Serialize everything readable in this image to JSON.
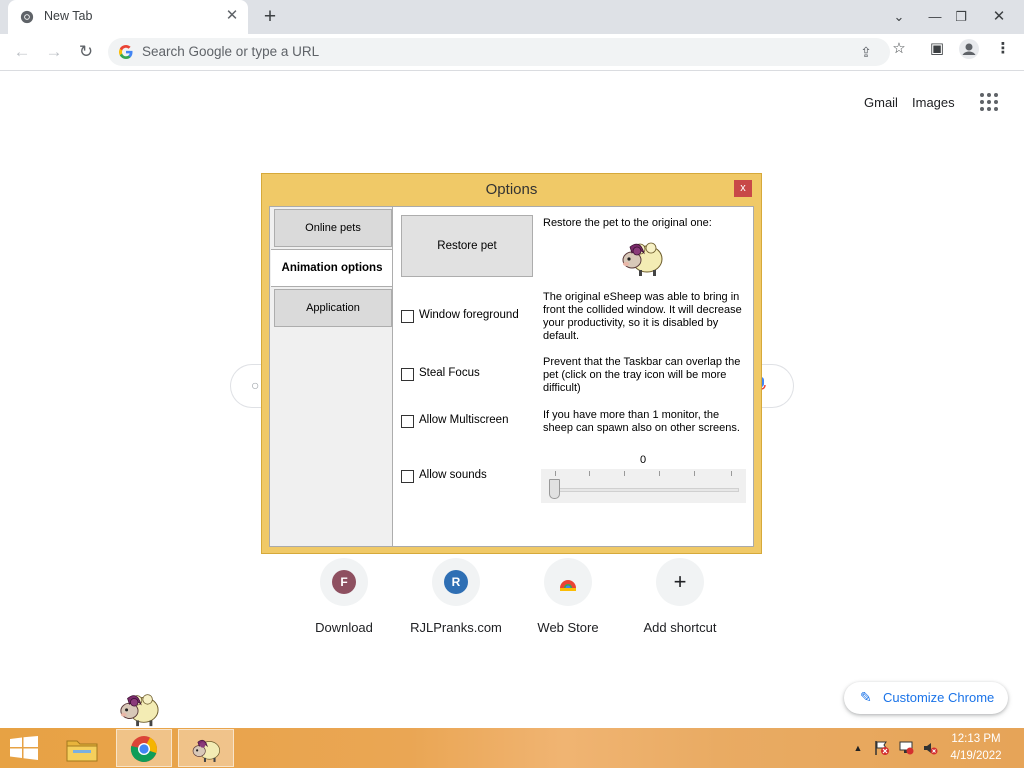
{
  "browser": {
    "tab_title": "New Tab",
    "omnibox_placeholder": "Search Google or type a URL"
  },
  "ntp": {
    "top_links": [
      "Gmail",
      "Images"
    ],
    "shortcuts": [
      {
        "label": "Download",
        "letter": "F",
        "color": "#8e5060"
      },
      {
        "label": "RJLPranks.com",
        "letter": "R",
        "color": "#2f6fb4"
      },
      {
        "label": "Web Store",
        "letter": "",
        "color": ""
      },
      {
        "label": "Add shortcut",
        "letter": "+",
        "color": ""
      }
    ],
    "customize_label": "Customize Chrome"
  },
  "dialog": {
    "title": "Options",
    "close": "x",
    "tabs": [
      "Online pets",
      "Animation options",
      "Application"
    ],
    "active_tab": "Animation options",
    "restore_button": "Restore pet",
    "checkboxes": [
      {
        "label": "Window foreground",
        "checked": false
      },
      {
        "label": "Steal Focus",
        "checked": false
      },
      {
        "label": "Allow Multiscreen",
        "checked": false
      },
      {
        "label": "Allow sounds",
        "checked": false
      }
    ],
    "descriptions": {
      "restore": "Restore the pet to the original one:",
      "foreground": "The original eSheep was able to bring in front the collided window. It will decrease your productivity, so it is disabled by default.",
      "focus": "Prevent that the Taskbar can overlap the pet (click on the tray icon will be more difficult)",
      "multiscreen": "If you have more than 1 monitor, the sheep can spawn also on other screens."
    },
    "volume_value": "0",
    "volume_level": 0
  },
  "taskbar": {
    "time": "12:13 PM",
    "date": "4/19/2022"
  }
}
